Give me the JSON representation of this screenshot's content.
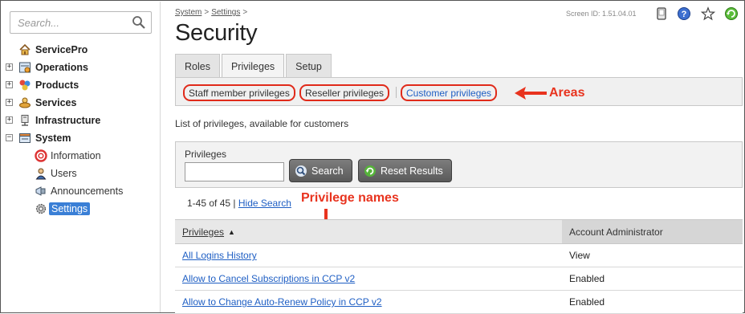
{
  "sidebar": {
    "search_placeholder": "Search...",
    "root": "ServicePro",
    "items": [
      {
        "label": "Operations",
        "icon": "operations-icon"
      },
      {
        "label": "Products",
        "icon": "products-icon"
      },
      {
        "label": "Services",
        "icon": "services-icon"
      },
      {
        "label": "Infrastructure",
        "icon": "infrastructure-icon"
      },
      {
        "label": "System",
        "icon": "system-icon"
      }
    ],
    "system_children": [
      {
        "label": "Information",
        "icon": "information-icon"
      },
      {
        "label": "Users",
        "icon": "users-icon"
      },
      {
        "label": "Announcements",
        "icon": "announcements-icon"
      },
      {
        "label": "Settings",
        "icon": "settings-icon"
      }
    ]
  },
  "header": {
    "breadcrumb": [
      "System",
      "Settings"
    ],
    "title": "Security",
    "screen_id": "Screen ID:  1.51.04.01"
  },
  "tabs": [
    "Roles",
    "Privileges",
    "Setup"
  ],
  "areas": [
    "Staff member privileges",
    "Reseller privileges",
    "Customer privileges"
  ],
  "annotations": {
    "areas": "Areas",
    "privilege_names": "Privilege names"
  },
  "description": "List of privileges, available for customers",
  "filter": {
    "label": "Privileges",
    "value": "",
    "search_btn": "Search",
    "reset_btn": "Reset Results"
  },
  "results": {
    "count": "1-45 of 45",
    "separator": "|",
    "hide_search": "Hide Search"
  },
  "table": {
    "headers": [
      "Privileges",
      "Account Administrator"
    ],
    "rows": [
      {
        "name": "All Logins History",
        "value": "View"
      },
      {
        "name": "Allow to Cancel Subscriptions in CCP v2",
        "value": "Enabled"
      },
      {
        "name": "Allow to Change Auto-Renew Policy in CCP v2",
        "value": "Enabled"
      }
    ]
  },
  "colors": {
    "accent": "#3a7fd6",
    "link": "#1f5fc4",
    "annotation": "#e8331e"
  }
}
